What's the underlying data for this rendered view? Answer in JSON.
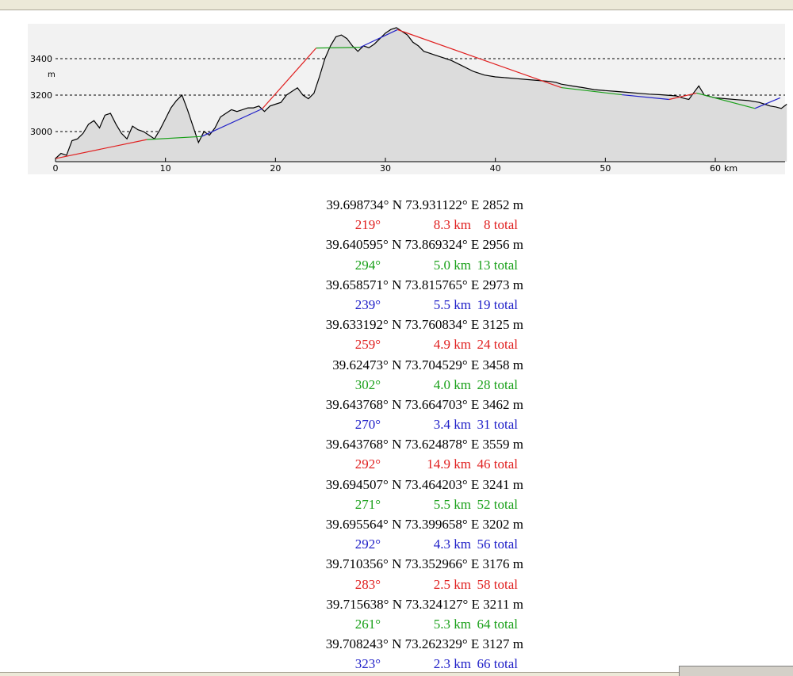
{
  "chart_data": {
    "type": "area",
    "xlabel": "km",
    "ylabel": "m",
    "x_ticks": [
      0,
      10,
      20,
      30,
      40,
      50,
      60
    ],
    "y_ticks": [
      3000,
      3200,
      3400
    ],
    "xlim": [
      0,
      66.5
    ],
    "ylim": [
      2825,
      3600
    ],
    "grid": "dashed horizontal lines at y ticks",
    "profile": {
      "color": "#000000",
      "x": [
        0,
        0.5,
        1,
        1.5,
        2,
        2.5,
        3,
        3.5,
        4,
        4.5,
        5,
        5.5,
        6,
        6.5,
        7,
        7.5,
        8,
        8.5,
        9,
        9.5,
        10,
        10.5,
        11,
        11.5,
        12,
        12.5,
        13,
        13.5,
        14,
        14.5,
        15,
        15.5,
        16,
        16.5,
        17,
        17.5,
        18,
        18.5,
        19,
        19.5,
        20,
        20.5,
        21,
        21.5,
        22,
        22.5,
        23,
        23.5,
        24,
        24.5,
        25,
        25.5,
        26,
        26.5,
        27,
        27.5,
        28,
        28.5,
        29,
        29.5,
        30,
        30.5,
        31,
        31.5,
        32,
        32.5,
        33,
        33.5,
        34,
        34.5,
        35,
        35.5,
        36,
        37,
        38,
        39,
        40,
        41,
        42,
        43,
        44,
        45,
        45.5,
        46,
        46.5,
        47,
        48,
        49,
        50,
        51,
        52,
        53,
        54,
        55,
        56,
        56.5,
        57,
        57.3,
        57.6,
        58,
        58.5,
        59,
        60,
        61,
        62,
        63,
        64,
        64.5,
        65,
        65.5,
        66,
        66.5
      ],
      "y": [
        2852,
        2880,
        2870,
        2950,
        2960,
        2990,
        3040,
        3060,
        3020,
        3090,
        3100,
        3040,
        2990,
        2960,
        3030,
        3010,
        3000,
        2980,
        2960,
        3010,
        3070,
        3130,
        3170,
        3200,
        3120,
        3030,
        2940,
        3000,
        2980,
        3020,
        3080,
        3100,
        3120,
        3110,
        3120,
        3130,
        3130,
        3140,
        3110,
        3140,
        3150,
        3160,
        3200,
        3220,
        3240,
        3200,
        3180,
        3210,
        3300,
        3400,
        3470,
        3520,
        3530,
        3510,
        3470,
        3440,
        3470,
        3460,
        3480,
        3510,
        3540,
        3560,
        3570,
        3550,
        3530,
        3490,
        3470,
        3440,
        3430,
        3420,
        3410,
        3400,
        3390,
        3360,
        3330,
        3310,
        3300,
        3295,
        3290,
        3285,
        3280,
        3275,
        3270,
        3260,
        3255,
        3250,
        3241,
        3230,
        3225,
        3220,
        3215,
        3210,
        3205,
        3202,
        3198,
        3195,
        3185,
        3180,
        3176,
        3210,
        3250,
        3200,
        3185,
        3180,
        3175,
        3170,
        3160,
        3150,
        3140,
        3135,
        3127,
        3150,
        3170,
        3190
      ]
    },
    "legs": [
      {
        "x": [
          0,
          8.3
        ],
        "y": [
          2852,
          2956
        ],
        "color": "#e02020"
      },
      {
        "x": [
          8.3,
          13.3
        ],
        "y": [
          2956,
          2973
        ],
        "color": "#1aa01a"
      },
      {
        "x": [
          13.3,
          18.8
        ],
        "y": [
          2973,
          3125
        ],
        "color": "#2020c8"
      },
      {
        "x": [
          18.8,
          23.7
        ],
        "y": [
          3125,
          3458
        ],
        "color": "#e02020"
      },
      {
        "x": [
          23.7,
          27.7
        ],
        "y": [
          3458,
          3462
        ],
        "color": "#1aa01a"
      },
      {
        "x": [
          27.7,
          31.1
        ],
        "y": [
          3462,
          3559
        ],
        "color": "#2020c8"
      },
      {
        "x": [
          31.1,
          46.0
        ],
        "y": [
          3559,
          3241
        ],
        "color": "#e02020"
      },
      {
        "x": [
          46.0,
          51.5
        ],
        "y": [
          3241,
          3202
        ],
        "color": "#1aa01a"
      },
      {
        "x": [
          51.5,
          55.8
        ],
        "y": [
          3202,
          3176
        ],
        "color": "#2020c8"
      },
      {
        "x": [
          55.8,
          58.3
        ],
        "y": [
          3176,
          3211
        ],
        "color": "#e02020"
      },
      {
        "x": [
          58.3,
          63.6
        ],
        "y": [
          3211,
          3127
        ],
        "color": "#1aa01a"
      },
      {
        "x": [
          63.6,
          65.9
        ],
        "y": [
          3127,
          3185
        ],
        "color": "#2020c8"
      }
    ]
  },
  "waypoints": [
    {
      "position": "39.698734° N 73.931122° E 2852 m",
      "bearing": "219°",
      "distance": "8.3 km",
      "total": "8 total",
      "color": "#e02020"
    },
    {
      "position": "39.640595° N 73.869324° E 2956 m",
      "bearing": "294°",
      "distance": "5.0 km",
      "total": "13 total",
      "color": "#1aa01a"
    },
    {
      "position": "39.658571° N 73.815765° E 2973 m",
      "bearing": "239°",
      "distance": "5.5 km",
      "total": "19 total",
      "color": "#2020c8"
    },
    {
      "position": "39.633192° N 73.760834° E 3125 m",
      "bearing": "259°",
      "distance": "4.9 km",
      "total": "24 total",
      "color": "#e02020"
    },
    {
      "position": "39.62473° N 73.704529° E 3458 m",
      "bearing": "302°",
      "distance": "4.0 km",
      "total": "28 total",
      "color": "#1aa01a"
    },
    {
      "position": "39.643768° N 73.664703° E 3462 m",
      "bearing": "270°",
      "distance": "3.4 km",
      "total": "31 total",
      "color": "#2020c8"
    },
    {
      "position": "39.643768° N 73.624878° E 3559 m",
      "bearing": "292°",
      "distance": "14.9 km",
      "total": "46 total",
      "color": "#e02020"
    },
    {
      "position": "39.694507° N 73.464203° E 3241 m",
      "bearing": "271°",
      "distance": "5.5 km",
      "total": "52 total",
      "color": "#1aa01a"
    },
    {
      "position": "39.695564° N 73.399658° E 3202 m",
      "bearing": "292°",
      "distance": "4.3 km",
      "total": "56 total",
      "color": "#2020c8"
    },
    {
      "position": "39.710356° N 73.352966° E 3176 m",
      "bearing": "283°",
      "distance": "2.5 km",
      "total": "58 total",
      "color": "#e02020"
    },
    {
      "position": "39.715638° N 73.324127° E 3211 m",
      "bearing": "261°",
      "distance": "5.3 km",
      "total": "64 total",
      "color": "#1aa01a"
    },
    {
      "position": "39.708243° N 73.262329° E 3127 m",
      "bearing": "323°",
      "distance": "2.3 km",
      "total": "66 total",
      "color": "#2020c8"
    }
  ]
}
